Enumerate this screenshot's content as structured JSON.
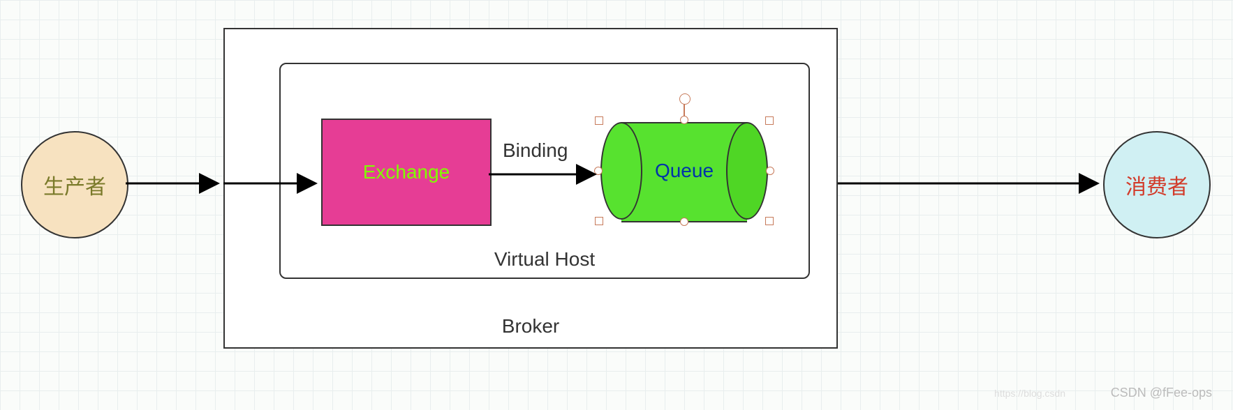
{
  "producer": {
    "label": "生产者"
  },
  "consumer": {
    "label": "消费者"
  },
  "broker": {
    "label": "Broker"
  },
  "vhost": {
    "label": "Virtual Host"
  },
  "exchange": {
    "label": "Exchange"
  },
  "queue": {
    "label": "Queue"
  },
  "binding": {
    "label": "Binding"
  },
  "watermark": {
    "faint": "https://blog.csdn",
    "main": "CSDN @fFee-ops"
  }
}
